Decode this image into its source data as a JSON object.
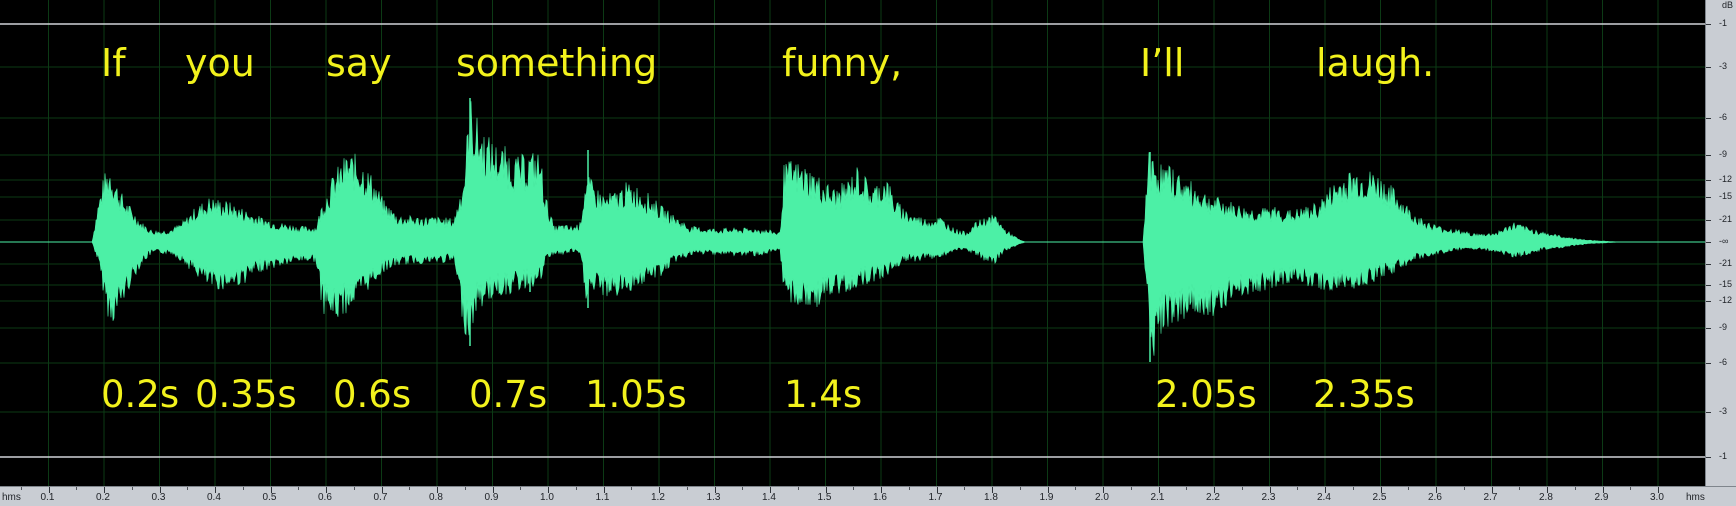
{
  "transcript": {
    "words": [
      "If",
      "you",
      "say",
      "something",
      "funny,",
      "I’ll",
      "laugh."
    ],
    "timestamps": [
      "0.2s",
      "0.35s",
      "0.6s",
      "0.7s",
      "1.05s",
      "1.4s",
      "2.05s",
      "2.35s"
    ]
  },
  "time_ruler": {
    "start_unit": "hms",
    "end_unit": "hms",
    "ticks": [
      "0.1",
      "0.2",
      "0.3",
      "0.4",
      "0.5",
      "0.6",
      "0.7",
      "0.8",
      "0.9",
      "1.0",
      "1.1",
      "1.2",
      "1.3",
      "1.4",
      "1.5",
      "1.6",
      "1.7",
      "1.8",
      "1.9",
      "2.0",
      "2.1",
      "2.2",
      "2.3",
      "2.4",
      "2.5",
      "2.6",
      "2.7",
      "2.8",
      "2.9",
      "3.0"
    ],
    "range_seconds": [
      0,
      3.0
    ]
  },
  "db_ruler": {
    "unit": "dB",
    "labels": [
      "-1",
      "-3",
      "-6",
      "-9",
      "-12",
      "-15",
      "-21",
      "-∞",
      "-21",
      "-15",
      "-12",
      "-9",
      "-6",
      "-3",
      "-1"
    ]
  },
  "colors": {
    "background": "#000000",
    "waveform": "#4cf0a6",
    "text": "#f2f21c",
    "grid": "#0c3a15",
    "rail": "#cfd3d8"
  },
  "waveform": {
    "segments_seconds": [
      [
        0.17,
        1.84
      ],
      [
        2.05,
        2.92
      ]
    ]
  }
}
